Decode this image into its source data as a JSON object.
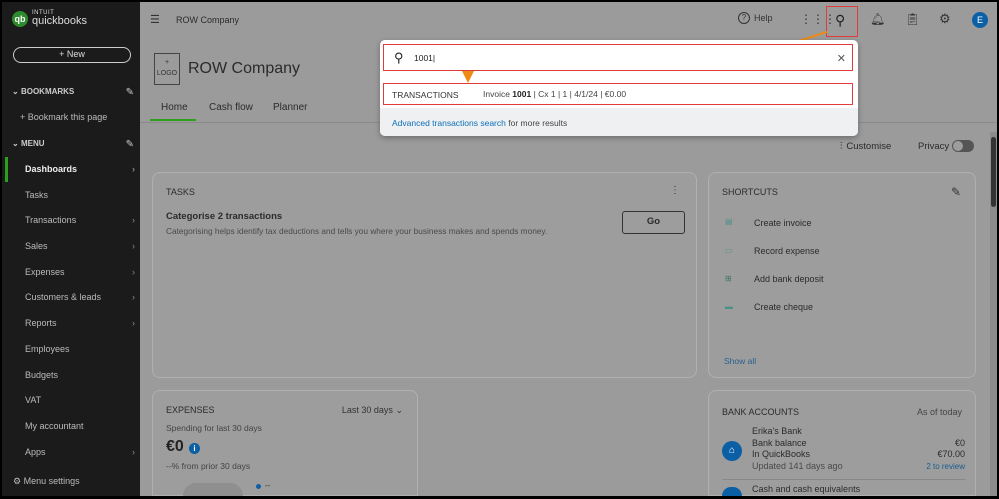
{
  "sidebar": {
    "brand_top": "INTUIT",
    "brand": "quickbooks",
    "new_label": "+ New",
    "bookmarks": "BOOKMARKS",
    "bookmark_this": "Bookmark this page",
    "menu": "MENU",
    "items": [
      {
        "label": "Dashboards"
      },
      {
        "label": "Tasks"
      },
      {
        "label": "Transactions"
      },
      {
        "label": "Sales"
      },
      {
        "label": "Expenses"
      },
      {
        "label": "Customers & leads"
      },
      {
        "label": "Reports"
      },
      {
        "label": "Employees"
      },
      {
        "label": "Budgets"
      },
      {
        "label": "VAT"
      },
      {
        "label": "My accountant"
      },
      {
        "label": "Apps"
      }
    ],
    "menu_settings": "Menu settings"
  },
  "header": {
    "company": "ROW Company",
    "help": "Help",
    "avatar": "E"
  },
  "page": {
    "logo_plus": "+",
    "logo_label": "LOGO",
    "title": "ROW Company",
    "tabs": [
      "Home",
      "Cash flow",
      "Planner"
    ],
    "customise": "Customise",
    "privacy": "Privacy"
  },
  "search": {
    "value": "1001",
    "section": "TRANSACTIONS",
    "result_prefix": "Invoice ",
    "result_bold": "1001",
    "result_rest": " | Cx 1 | 1 | 4/1/24 | €0.00",
    "advanced_link": "Advanced transactions search",
    "advanced_rest": " for more results"
  },
  "tasks": {
    "title": "TASKS",
    "heading": "Categorise 2 transactions",
    "desc": "Categorising helps identify tax deductions and tells you where your business makes and spends money.",
    "go": "Go"
  },
  "shortcuts": {
    "title": "SHORTCUTS",
    "items": [
      "Create invoice",
      "Record expense",
      "Add bank deposit",
      "Create cheque"
    ],
    "show_all": "Show all"
  },
  "expenses": {
    "title": "EXPENSES",
    "range": "Last 30 days",
    "sub": "Spending for last 30 days",
    "amount": "€0",
    "change": "--% from prior 30 days",
    "legend": "--"
  },
  "bank": {
    "title": "BANK ACCOUNTS",
    "asof": "As of today",
    "name": "Erika's Bank",
    "bank_balance_label": "Bank balance",
    "bank_balance": "€0",
    "inqb_label": "In QuickBooks",
    "inqb": "€70.00",
    "updated": "Updated 141 days ago",
    "review": "2 to review",
    "next": "Cash and cash equivalents"
  },
  "colors": {
    "accent": "#2ca01c",
    "link": "#0b5fa5",
    "highlight": "#e03c3c",
    "arrow": "#f08a12"
  }
}
